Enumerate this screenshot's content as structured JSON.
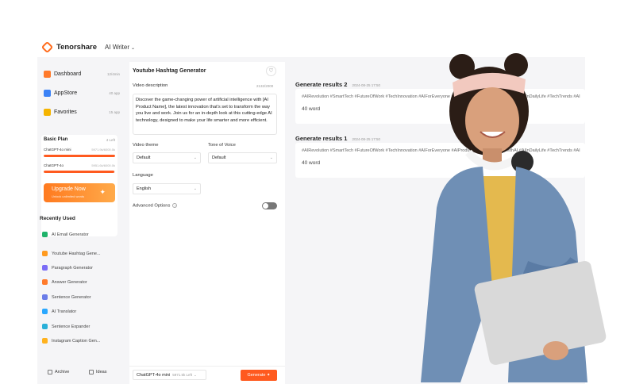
{
  "brand": {
    "name": "Tenorshare",
    "product": "AI Writer"
  },
  "sidebar": {
    "nav": [
      {
        "label": "Dashboard",
        "count": "12/4min",
        "color": "#ff7a2a"
      },
      {
        "label": "AppStore",
        "count": "40 app",
        "color": "#3b82f6"
      },
      {
        "label": "Favorites",
        "count": "15 app",
        "color": "#f5b400"
      }
    ],
    "plan": {
      "title": "Basic Plan",
      "left": "4 Left",
      "quotas": [
        {
          "name": "ChatGPT-4o mini",
          "value": "5971.9k/6000.0k",
          "fraction": 0.995
        },
        {
          "name": "ChatGPT-4o",
          "value": "5951.6k/6000.0k",
          "fraction": 0.992
        }
      ],
      "upgrade": {
        "title": "Upgrade Now",
        "subtitle": "Unlock unlimited words"
      }
    },
    "recent_title": "Recently Used",
    "recent": [
      {
        "label": "AI Email Generator",
        "color": "#1fb36b"
      },
      {
        "label": "Youtube Hashtag Gene...",
        "color": "#ff9a1f"
      },
      {
        "label": "Paragraph Generator",
        "color": "#7b6cf6"
      },
      {
        "label": "Answer Generator",
        "color": "#ff7a2a"
      },
      {
        "label": "Sentence Generator",
        "color": "#6a7ce8"
      },
      {
        "label": "AI Translator",
        "color": "#2aa8ff"
      },
      {
        "label": "Sentence Expander",
        "color": "#2ab0d8"
      },
      {
        "label": "Instagram Caption Gen...",
        "color": "#ffb21f"
      }
    ],
    "footer": {
      "archive": "Archive",
      "ideas": "Ideas"
    }
  },
  "form": {
    "title": "Youtube Hashtag Generator",
    "desc_label": "Video description",
    "desc_count": "2132/2000",
    "desc_value": "Discover the game-changing power of artificial intelligence with [AI Product Name], the latest innovation that's set to transform the way you live and work. Join us for an in-depth look at this cutting-edge AI technology, designed to make your life smarter and more efficient.",
    "theme_label": "Video theme",
    "theme_value": "Default",
    "tone_label": "Tone of Voice",
    "tone_value": "Default",
    "lang_label": "Language",
    "lang_value": "English",
    "advanced_label": "Advanced Options",
    "advanced_on": false,
    "model": "ChatGPT-4o mini",
    "model_left": "5971.5k Left",
    "generate": "Generate"
  },
  "results": [
    {
      "title": "Generate results 2",
      "date": "2024-08-25 17:50",
      "tags": "#AIRevolution #SmartTech #FutureOfWork #TechInnovation #AIForEveryone #AIProductName #InnovateWithAI #AIInDailyLife #TechTrends #AI",
      "words": "40 word"
    },
    {
      "title": "Generate results 1",
      "date": "2024-08-25 17:50",
      "tags": "#AIRevolution #SmartTech #FutureOfWork #TechInnovation #AIForEveryone #AIProductName #InnovateWithAI #AIInDailyLife #TechTrends #AI",
      "words": "40 word"
    }
  ]
}
